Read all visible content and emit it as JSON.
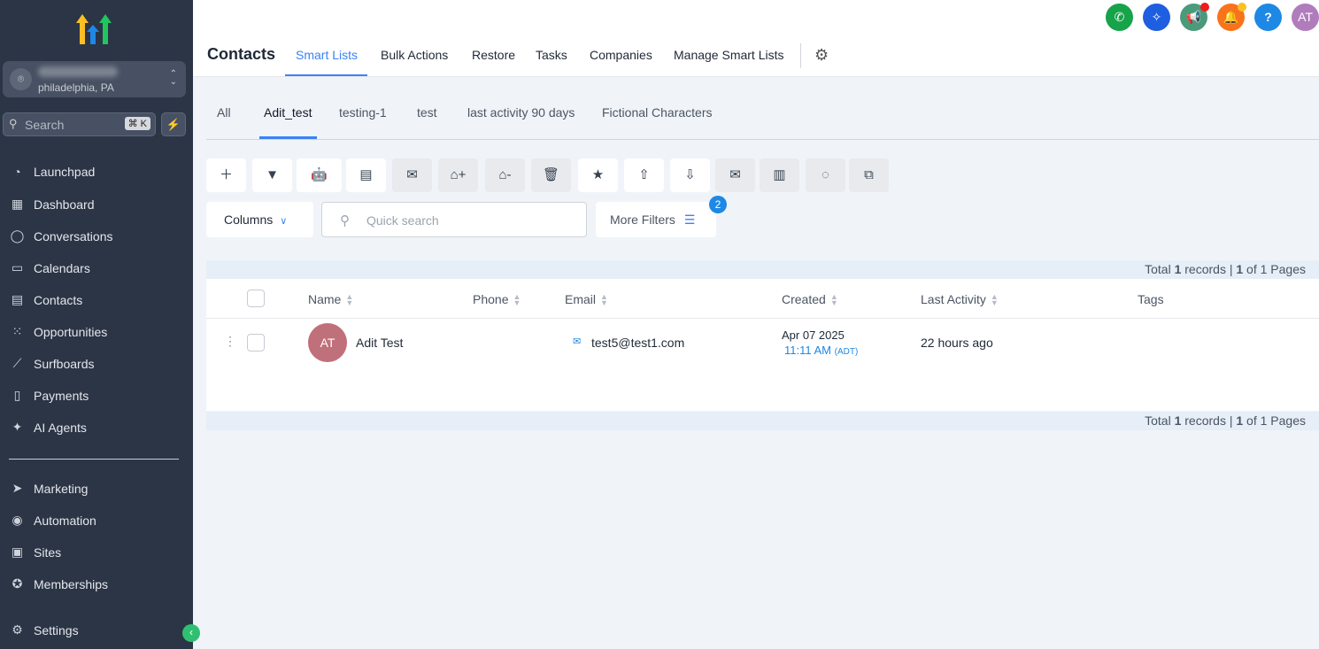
{
  "sidebar": {
    "location_city": "philadelphia, PA",
    "search_placeholder": "Search",
    "search_shortcut": "⌘ K",
    "items": [
      {
        "label": "Launchpad",
        "icon": "rocket-icon"
      },
      {
        "label": "Dashboard",
        "icon": "grid-icon"
      },
      {
        "label": "Conversations",
        "icon": "chat-icon"
      },
      {
        "label": "Calendars",
        "icon": "calendar-icon"
      },
      {
        "label": "Contacts",
        "icon": "contacts-icon"
      },
      {
        "label": "Opportunities",
        "icon": "opportunities-icon"
      },
      {
        "label": "Surfboards",
        "icon": "surfboard-icon"
      },
      {
        "label": "Payments",
        "icon": "payments-icon"
      },
      {
        "label": "AI Agents",
        "icon": "sparkle-icon"
      }
    ],
    "items2": [
      {
        "label": "Marketing",
        "icon": "send-icon"
      },
      {
        "label": "Automation",
        "icon": "automation-icon"
      },
      {
        "label": "Sites",
        "icon": "sites-icon"
      },
      {
        "label": "Memberships",
        "icon": "award-icon"
      }
    ],
    "settings": "Settings"
  },
  "header": {
    "title": "Contacts",
    "tabs": [
      "Smart Lists",
      "Bulk Actions",
      "Restore",
      "Tasks",
      "Companies",
      "Manage Smart Lists"
    ],
    "avatar": "AT",
    "help": "?"
  },
  "smart_lists": [
    "All",
    "Adit_test",
    "testing-1",
    "test",
    "last activity 90 days",
    "Fictional Characters"
  ],
  "toolbar": {
    "columns": "Columns",
    "search_placeholder": "Quick search",
    "more_filters": "More Filters",
    "filter_count": "2"
  },
  "totals": {
    "prefix": "Total ",
    "count": "1",
    "mid": " records | ",
    "page": "1",
    "suffix": " of 1 Pages"
  },
  "table": {
    "headers": [
      "Name",
      "Phone",
      "Email",
      "Created",
      "Last Activity",
      "Tags"
    ],
    "rows": [
      {
        "initials": "AT",
        "name": "Adit Test",
        "phone": "",
        "email": "test5@test1.com",
        "created_date": "Apr 07 2025",
        "created_time": "11:11 AM",
        "tz": "(ADT)",
        "last_activity": "22 hours ago",
        "tags": ""
      }
    ]
  },
  "colors": {
    "accent": "#3b82f6",
    "sidebar": "#2b3546"
  }
}
